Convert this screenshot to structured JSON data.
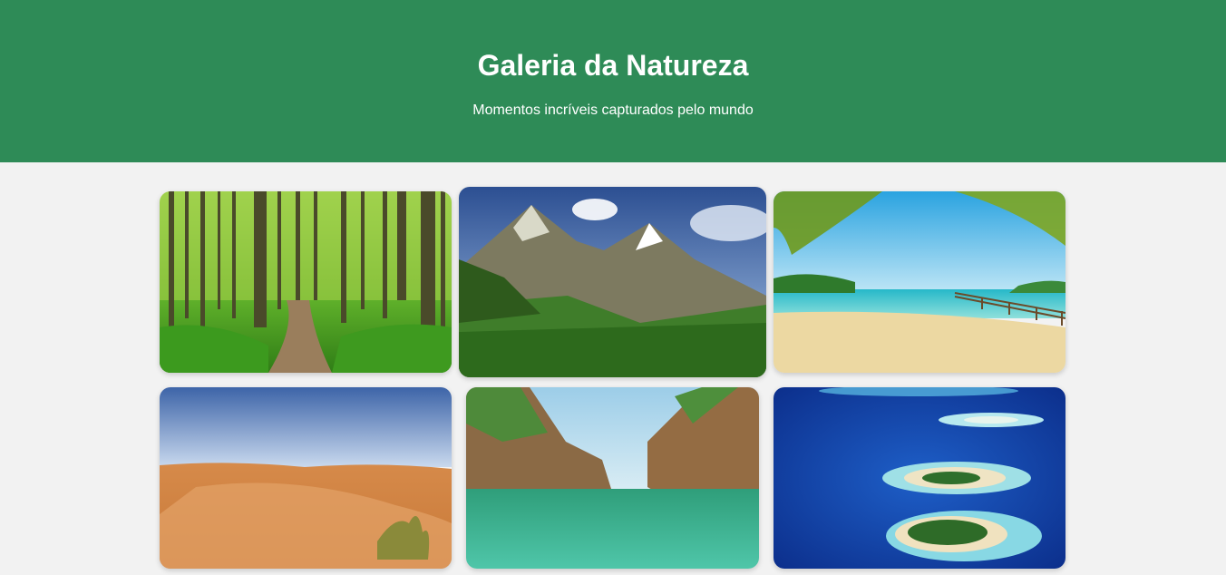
{
  "header": {
    "title": "Galeria da Natureza",
    "subtitle": "Momentos incríveis capturados pelo mundo"
  },
  "colors": {
    "header_bg": "#2e8b57",
    "page_bg": "#f2f2f2",
    "header_text": "#ffffff"
  },
  "gallery": [
    {
      "subject": "forest-path"
    },
    {
      "subject": "mountains"
    },
    {
      "subject": "tropical-beach"
    },
    {
      "subject": "desert-dunes"
    },
    {
      "subject": "canyon-lake"
    },
    {
      "subject": "atoll-islands"
    }
  ]
}
